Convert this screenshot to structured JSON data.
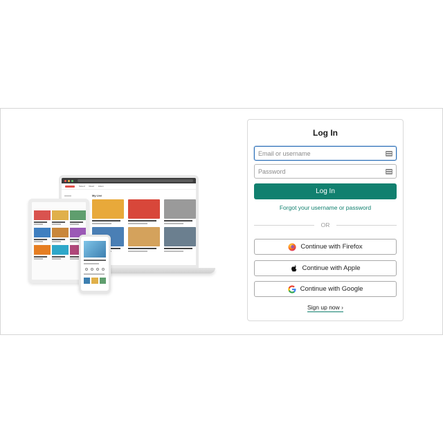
{
  "illustration": {
    "laptop_tabs": [
      "Saved",
      "Read",
      "Listen"
    ],
    "laptop_heading": "My List",
    "card_colors": [
      "#e8a93a",
      "#d8473a",
      "#9a9a9a",
      "#4a7fb5",
      "#d4a25c",
      "#6b7f8f"
    ],
    "tablet_colors": [
      "#d9534f",
      "#e0b04a",
      "#5f9e6e",
      "#3f7fc0",
      "#c9873b",
      "#9b59b6",
      "#e67e22",
      "#2ea7c9",
      "#b0487a"
    ],
    "phone_thumb_colors": [
      "#3d7fb0",
      "#e0b04a",
      "#5f9e6e"
    ]
  },
  "login": {
    "title": "Log In",
    "email_placeholder": "Email or username",
    "password_placeholder": "Password",
    "submit_label": "Log In",
    "forgot_label": "Forgot your username or password",
    "or_label": "OR",
    "firefox_label": "Continue with Firefox",
    "apple_label": "Continue with Apple",
    "google_label": "Continue with Google",
    "signup_label": "Sign up now ›"
  },
  "colors": {
    "accent": "#11806f",
    "focus_border": "#2b6fb8"
  },
  "icons": {
    "firefox": "firefox-icon",
    "apple": "apple-icon",
    "google": "google-icon",
    "password_manager": "key-icon"
  }
}
